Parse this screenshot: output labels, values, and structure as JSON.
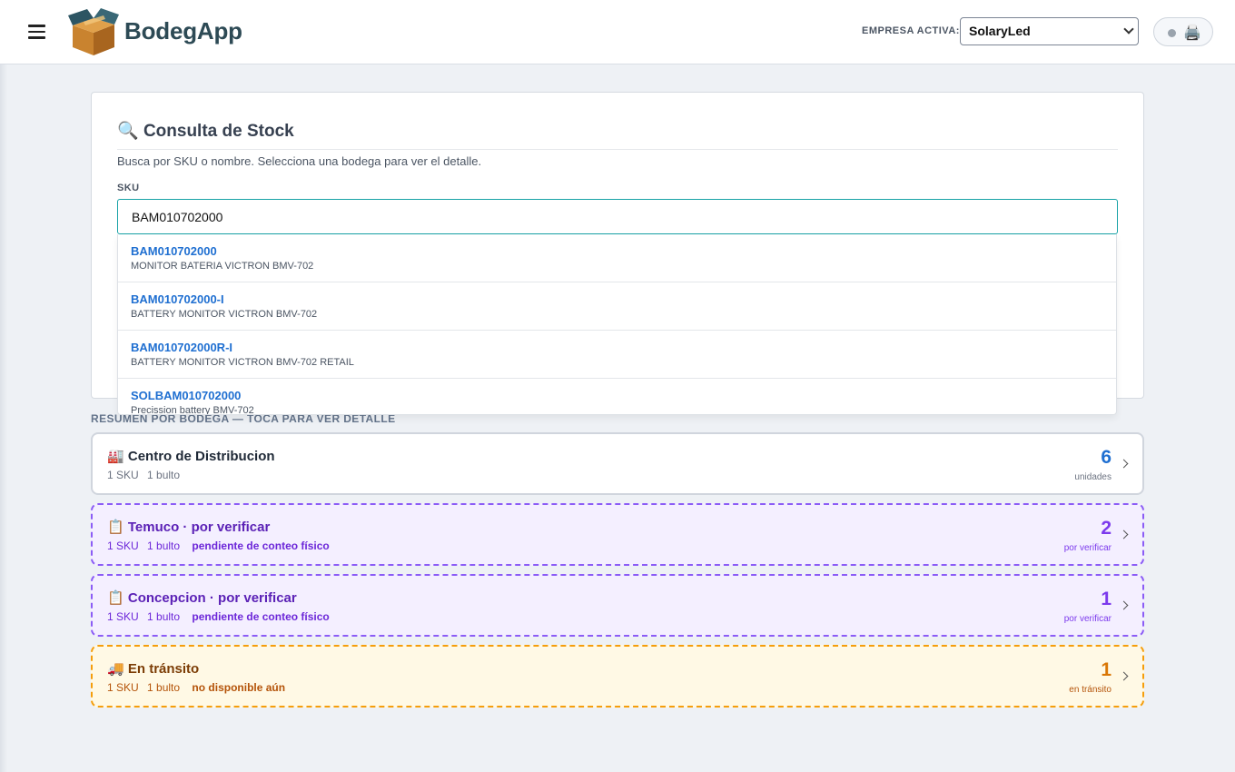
{
  "header": {
    "brand": "BodegApp",
    "empresa_label": "EMPRESA ACTIVA:",
    "empresa_selected": "SolaryLed"
  },
  "card": {
    "icon": "🔍",
    "title": "Consulta de Stock",
    "subtitle": "Busca por SKU o nombre. Selecciona una bodega para ver el detalle.",
    "sku_label": "SKU",
    "sku_value": "BAM010702000"
  },
  "suggestions": [
    {
      "code": "BAM010702000",
      "desc": "MONITOR BATERIA VICTRON BMV-702"
    },
    {
      "code": "BAM010702000-I",
      "desc": "BATTERY MONITOR VICTRON BMV-702"
    },
    {
      "code": "BAM010702000R-I",
      "desc": "BATTERY MONITOR VICTRON BMV-702 RETAIL"
    },
    {
      "code": "SOLBAM010702000",
      "desc": "Precission battery BMV-702"
    }
  ],
  "summary_label": "RESUMEN POR BODEGA — TOCA PARA VER DETALLE",
  "bodegas": [
    {
      "icon": "🏭",
      "name": "Centro de Distribucion",
      "skus": "1 SKU",
      "bultos": "1 bulto",
      "note": "",
      "count": "6",
      "unit": "unidades",
      "style": "solid"
    },
    {
      "icon": "📋",
      "name": "Temuco · por verificar",
      "skus": "1 SKU",
      "bultos": "1 bulto",
      "note": "pendiente de conteo físico",
      "count": "2",
      "unit": "por verificar",
      "style": "purple"
    },
    {
      "icon": "📋",
      "name": "Concepcion · por verificar",
      "skus": "1 SKU",
      "bultos": "1 bulto",
      "note": "pendiente de conteo físico",
      "count": "1",
      "unit": "por verificar",
      "style": "purple"
    },
    {
      "icon": "🚚",
      "name": "En tránsito",
      "skus": "1 SKU",
      "bultos": "1 bulto",
      "note": "no disponible aún",
      "count": "1",
      "unit": "en tránsito",
      "style": "amber"
    }
  ],
  "icons": {
    "menu": "hamburger-icon",
    "logo": "cardboard-box-logo",
    "status": "status-dot-icon",
    "printer": "printer-icon"
  },
  "colors": {
    "brand_text": "#2d4a55",
    "input_focus": "#17a2a6",
    "link_blue": "#1f6fd1",
    "purple": "#7c3aed",
    "amber": "#d97706"
  }
}
